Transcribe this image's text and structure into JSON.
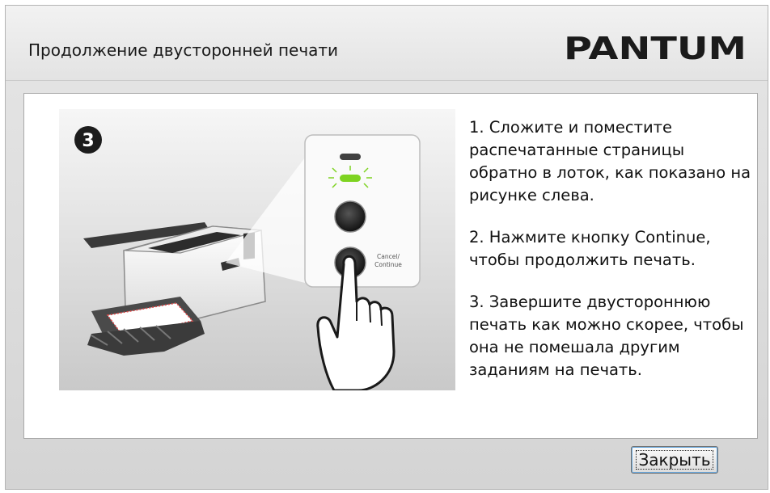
{
  "dialog": {
    "title": "Продолжение двусторонней печати",
    "logo_text": "PANTUM",
    "close_button": "Закрыть"
  },
  "illustration": {
    "step_number": "3",
    "button_label_line1": "Cancel/",
    "button_label_line2": "Continue",
    "indicator_color": "#7ed321"
  },
  "instructions": [
    "1. Сложите и поместите распечатанные страницы обратно в лоток, как показано на рисунке слева.",
    "2. Нажмите кнопку Continue, чтобы продолжить печать.",
    "3. Завершите двустороннюю печать как можно скорее, чтобы она не помешала другим заданиям на печать."
  ]
}
